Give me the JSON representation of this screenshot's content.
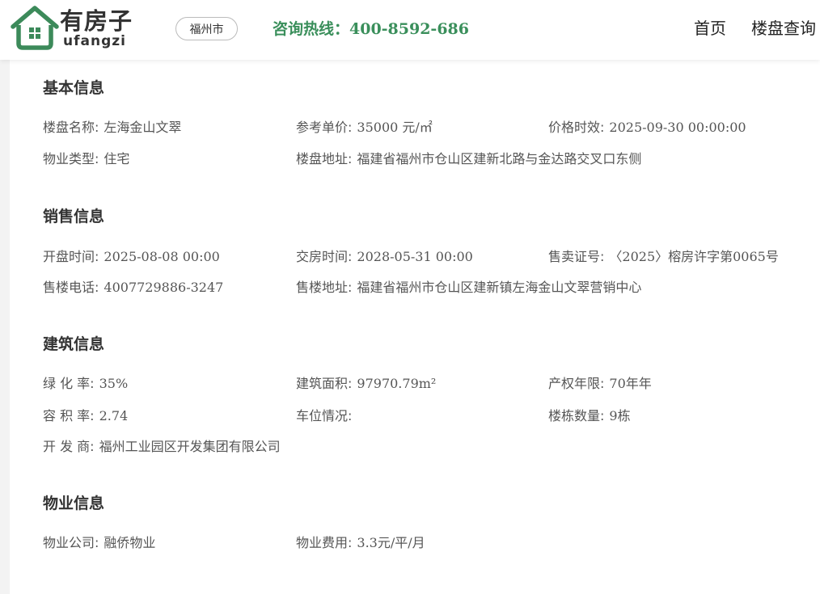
{
  "header": {
    "logo_cn": "有房子",
    "logo_en": "ufangzi",
    "city": "福州市",
    "hotline": "咨询热线：400-8592-686",
    "nav": [
      "首页",
      "楼盘查询"
    ]
  },
  "sections": {
    "basic": {
      "title": "基本信息",
      "name_label": "楼盘名称:",
      "name_value": "左海金山文翠",
      "price_label": "参考单价:",
      "price_value": "35000 元/㎡",
      "validity_label": "价格时效:",
      "validity_value": "2025-09-30 00:00:00",
      "type_label": "物业类型:",
      "type_value": "住宅",
      "address_label": "楼盘地址:",
      "address_value": "福建省福州市仓山区建新北路与金达路交叉口东侧"
    },
    "sales": {
      "title": "销售信息",
      "open_label": "开盘时间:",
      "open_value": "2025-08-08 00:00",
      "delivery_label": "交房时间:",
      "delivery_value": "2028-05-31 00:00",
      "permit_label": "售卖证号:",
      "permit_value": "〈2025〉榕房许字第0065号",
      "phone_label": "售楼电话:",
      "phone_value": "4007729886-3247",
      "sales_address_label": "售楼地址:",
      "sales_address_value": "福建省福州市仓山区建新镇左海金山文翠营销中心"
    },
    "building": {
      "title": "建筑信息",
      "green_label": "绿 化 率:",
      "green_value": "35%",
      "area_label": "建筑面积:",
      "area_value": "97970.79m²",
      "term_label": "产权年限:",
      "term_value": "70年年",
      "plot_label": "容 积 率:",
      "plot_value": "2.74",
      "parking_label": "车位情况:",
      "parking_value": "",
      "count_label": "楼栋数量:",
      "count_value": "9栋",
      "developer_label": "开 发 商:",
      "developer_value": "福州工业园区开发集团有限公司"
    },
    "property": {
      "title": "物业信息",
      "company_label": "物业公司:",
      "company_value": "融侨物业",
      "fee_label": "物业费用:",
      "fee_value": "3.3元/平/月"
    }
  },
  "colors": {
    "brand_green": "#3a8f5b",
    "logo_green": "#3c8a5a"
  },
  "icons": {
    "logo": "house-logo-icon"
  }
}
